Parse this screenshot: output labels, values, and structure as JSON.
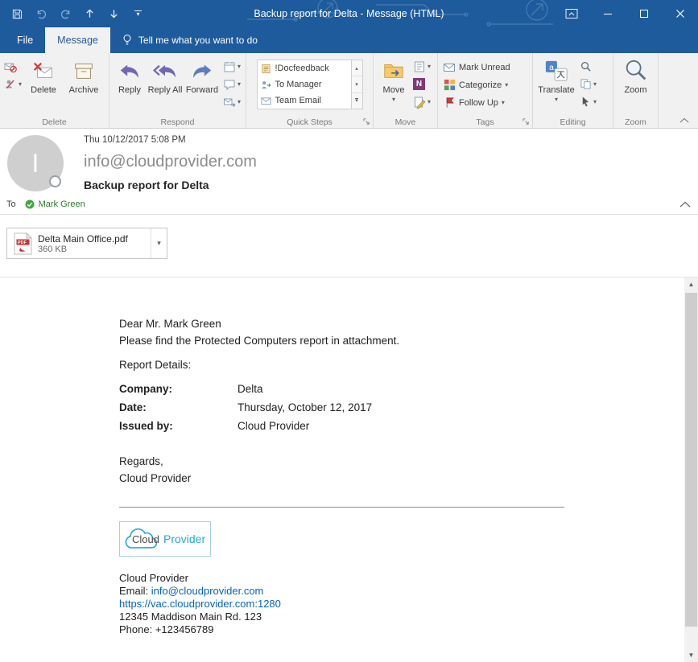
{
  "window": {
    "title": "Backup report for Delta  -  Message (HTML)"
  },
  "tabs": {
    "file": "File",
    "message": "Message",
    "tellme": "Tell me what you want to do"
  },
  "ribbon": {
    "delete_group": {
      "label": "Delete",
      "delete": "Delete",
      "archive": "Archive"
    },
    "respond_group": {
      "label": "Respond",
      "reply": "Reply",
      "reply_all": "Reply All",
      "forward": "Forward"
    },
    "quick_steps": {
      "label": "Quick Steps",
      "items": [
        "!Docfeedback",
        "To Manager",
        "Team Email"
      ]
    },
    "move_group": {
      "label": "Move",
      "move": "Move"
    },
    "tags_group": {
      "label": "Tags",
      "mark_unread": "Mark Unread",
      "categorize": "Categorize",
      "follow_up": "Follow Up"
    },
    "editing_group": {
      "label": "Editing",
      "translate": "Translate"
    },
    "zoom_group": {
      "label": "Zoom",
      "zoom": "Zoom"
    }
  },
  "header": {
    "date": "Thu 10/12/2017 5:08 PM",
    "sender": "info@cloudprovider.com",
    "subject": "Backup report for Delta",
    "to_label": "To",
    "recipient": "Mark Green",
    "avatar_initial": "I"
  },
  "attachment": {
    "filename": "Delta Main Office.pdf",
    "size": "360 KB",
    "badge": "PDF"
  },
  "body": {
    "greeting": "Dear Mr. Mark Green",
    "intro": "Please find the Protected Computers report in attachment.",
    "details_heading": "Report Details:",
    "details": [
      {
        "label": "Company:",
        "value": "Delta"
      },
      {
        "label": "Date:",
        "value": "Thursday, October 12, 2017"
      },
      {
        "label": "Issued by:",
        "value": "Cloud Provider"
      }
    ],
    "regards_line1": "Regards,",
    "regards_line2": "Cloud Provider",
    "logo_cloud": "Cloud",
    "logo_provider": "Provider",
    "sig_name": "Cloud Provider",
    "sig_email_label": "Email: ",
    "sig_email": "info@cloudprovider.com",
    "sig_url": "https://vac.cloudprovider.com:1280",
    "sig_address": "12345 Maddison Main Rd. 123",
    "sig_phone": "Phone: +123456789"
  },
  "colors": {
    "titlebar": "#1d5b9c",
    "accent": "#2b579a",
    "link": "#0563c1",
    "recipient_green": "#2c7a2c",
    "flag_red": "#d13b3b"
  }
}
